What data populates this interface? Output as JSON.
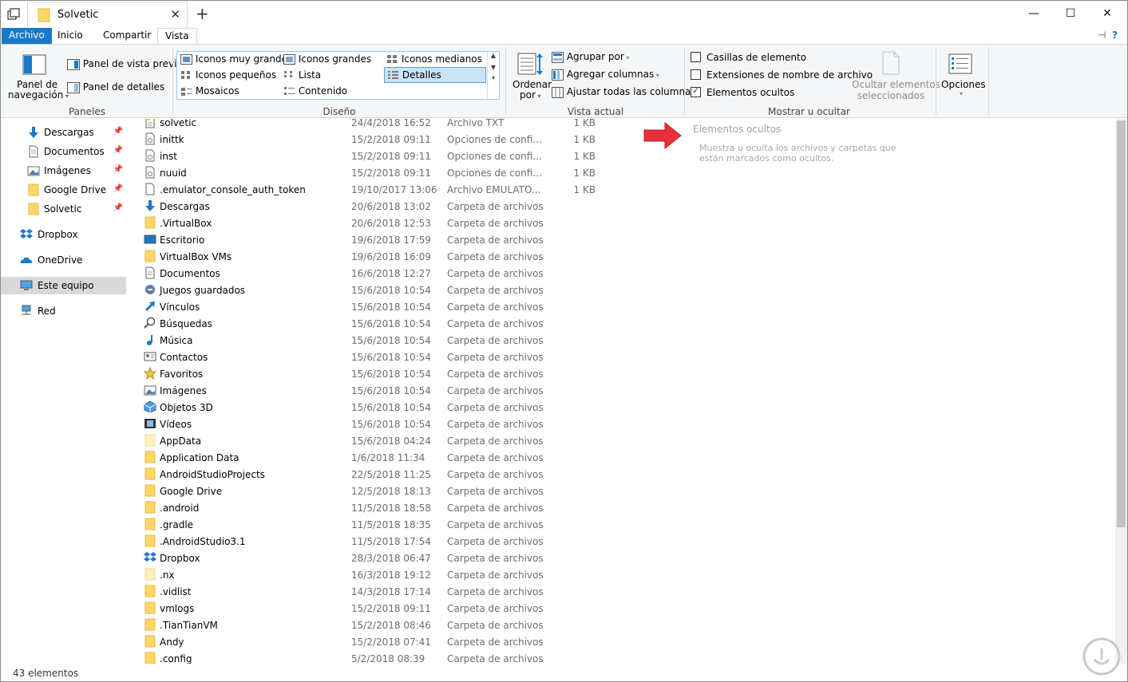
{
  "window": {
    "title": "Solvetic"
  },
  "ribbon_tabs": {
    "archivo": "Archivo",
    "inicio": "Inicio",
    "compartir": "Compartir",
    "vista": "Vista"
  },
  "ribbon": {
    "paneles": {
      "label": "Paneles",
      "nav_pane_line1": "Panel de",
      "nav_pane_line2": "navegación",
      "preview_pane": "Panel de vista previa",
      "details_pane": "Panel de detalles"
    },
    "diseno": {
      "label": "Diseño",
      "items": [
        "Iconos muy grandes",
        "Iconos grandes",
        "Iconos medianos",
        "Iconos pequeños",
        "Lista",
        "Detalles",
        "Mosaicos",
        "Contenido"
      ],
      "selected": "Detalles"
    },
    "vista_actual": {
      "label": "Vista actual",
      "ordenar_line1": "Ordenar",
      "ordenar_line2": "por",
      "agrupar": "Agrupar por",
      "agregar_columnas": "Agregar columnas",
      "ajustar": "Ajustar todas las columnas"
    },
    "mostrar": {
      "label": "Mostrar u ocultar",
      "casillas": "Casillas de elemento",
      "casillas_checked": false,
      "extensiones": "Extensiones de nombre de archivo",
      "extensiones_checked": false,
      "ocultos": "Elementos ocultos",
      "ocultos_checked": true,
      "ocultar_sel_line1": "Ocultar elementos",
      "ocultar_sel_line2": "seleccionados"
    },
    "opciones": "Opciones"
  },
  "nav": {
    "items": [
      {
        "label": "Descargas",
        "icon": "download-arrow-icon",
        "pinned": true
      },
      {
        "label": "Documentos",
        "icon": "document-icon",
        "pinned": true
      },
      {
        "label": "Imágenes",
        "icon": "pictures-icon",
        "pinned": true
      },
      {
        "label": "Google Drive",
        "icon": "folder-icon",
        "pinned": true
      },
      {
        "label": "Solvetic",
        "icon": "folder-icon",
        "pinned": true
      },
      {
        "label": "Dropbox",
        "icon": "dropbox-icon",
        "pinned": false
      },
      {
        "label": "OneDrive",
        "icon": "onedrive-cloud-icon",
        "pinned": false
      },
      {
        "label": "Este equipo",
        "icon": "computer-icon",
        "pinned": false
      },
      {
        "label": "Red",
        "icon": "network-icon",
        "pinned": false
      }
    ],
    "selected": "Este equipo"
  },
  "files": [
    {
      "name": "solvetic",
      "date": "24/4/2018 16:52",
      "type": "Archivo TXT",
      "size": "1 KB",
      "icon": "text-file-icon"
    },
    {
      "name": "inittk",
      "date": "15/2/2018 09:11",
      "type": "Opciones de confi...",
      "size": "1 KB",
      "icon": "settings-file-icon"
    },
    {
      "name": "inst",
      "date": "15/2/2018 09:11",
      "type": "Opciones de confi...",
      "size": "1 KB",
      "icon": "settings-file-icon"
    },
    {
      "name": "nuuid",
      "date": "15/2/2018 09:11",
      "type": "Opciones de confi...",
      "size": "1 KB",
      "icon": "settings-file-icon"
    },
    {
      "name": ".emulator_console_auth_token",
      "date": "19/10/2017 13:06",
      "type": "Archivo EMULATO...",
      "size": "1 KB",
      "icon": "blank-file-icon"
    },
    {
      "name": "Descargas",
      "date": "20/6/2018 13:02",
      "type": "Carpeta de archivos",
      "size": "",
      "icon": "download-arrow-icon"
    },
    {
      "name": ".VirtualBox",
      "date": "20/6/2018 12:53",
      "type": "Carpeta de archivos",
      "size": "",
      "icon": "folder-icon"
    },
    {
      "name": "Escritorio",
      "date": "19/6/2018 17:59",
      "type": "Carpeta de archivos",
      "size": "",
      "icon": "desktop-icon"
    },
    {
      "name": "VirtualBox VMs",
      "date": "19/6/2018 16:09",
      "type": "Carpeta de archivos",
      "size": "",
      "icon": "folder-icon"
    },
    {
      "name": "Documentos",
      "date": "16/6/2018 12:27",
      "type": "Carpeta de archivos",
      "size": "",
      "icon": "document-icon"
    },
    {
      "name": "Juegos guardados",
      "date": "15/6/2018 10:54",
      "type": "Carpeta de archivos",
      "size": "",
      "icon": "saved-games-icon"
    },
    {
      "name": "Vínculos",
      "date": "15/6/2018 10:54",
      "type": "Carpeta de archivos",
      "size": "",
      "icon": "link-arrow-icon"
    },
    {
      "name": "Búsquedas",
      "date": "15/6/2018 10:54",
      "type": "Carpeta de archivos",
      "size": "",
      "icon": "search-icon"
    },
    {
      "name": "Música",
      "date": "15/6/2018 10:54",
      "type": "Carpeta de archivos",
      "size": "",
      "icon": "music-note-icon"
    },
    {
      "name": "Contactos",
      "date": "15/6/2018 10:54",
      "type": "Carpeta de archivos",
      "size": "",
      "icon": "contacts-icon"
    },
    {
      "name": "Favoritos",
      "date": "15/6/2018 10:54",
      "type": "Carpeta de archivos",
      "size": "",
      "icon": "star-icon"
    },
    {
      "name": "Imágenes",
      "date": "15/6/2018 10:54",
      "type": "Carpeta de archivos",
      "size": "",
      "icon": "pictures-icon"
    },
    {
      "name": "Objetos 3D",
      "date": "15/6/2018 10:54",
      "type": "Carpeta de archivos",
      "size": "",
      "icon": "cube-3d-icon"
    },
    {
      "name": "Vídeos",
      "date": "15/6/2018 10:54",
      "type": "Carpeta de archivos",
      "size": "",
      "icon": "film-icon"
    },
    {
      "name": "AppData",
      "date": "15/6/2018 04:24",
      "type": "Carpeta de archivos",
      "size": "",
      "icon": "folder-faded-icon"
    },
    {
      "name": "Application Data",
      "date": "1/6/2018 11:34",
      "type": "Carpeta de archivos",
      "size": "",
      "icon": "folder-icon"
    },
    {
      "name": "AndroidStudioProjects",
      "date": "22/5/2018 11:25",
      "type": "Carpeta de archivos",
      "size": "",
      "icon": "folder-icon"
    },
    {
      "name": "Google Drive",
      "date": "12/5/2018 18:13",
      "type": "Carpeta de archivos",
      "size": "",
      "icon": "folder-icon"
    },
    {
      "name": ".android",
      "date": "11/5/2018 18:58",
      "type": "Carpeta de archivos",
      "size": "",
      "icon": "folder-icon"
    },
    {
      "name": ".gradle",
      "date": "11/5/2018 18:35",
      "type": "Carpeta de archivos",
      "size": "",
      "icon": "folder-icon"
    },
    {
      "name": ".AndroidStudio3.1",
      "date": "11/5/2018 17:54",
      "type": "Carpeta de archivos",
      "size": "",
      "icon": "folder-icon"
    },
    {
      "name": "Dropbox",
      "date": "28/3/2018 06:47",
      "type": "Carpeta de archivos",
      "size": "",
      "icon": "dropbox-icon"
    },
    {
      "name": ".nx",
      "date": "16/3/2018 19:12",
      "type": "Carpeta de archivos",
      "size": "",
      "icon": "folder-faded-icon"
    },
    {
      "name": ".vidlist",
      "date": "14/3/2018 17:14",
      "type": "Carpeta de archivos",
      "size": "",
      "icon": "folder-icon"
    },
    {
      "name": "vmlogs",
      "date": "15/2/2018 09:11",
      "type": "Carpeta de archivos",
      "size": "",
      "icon": "folder-icon"
    },
    {
      "name": ".TianTianVM",
      "date": "15/2/2018 08:46",
      "type": "Carpeta de archivos",
      "size": "",
      "icon": "folder-icon"
    },
    {
      "name": "Andy",
      "date": "15/2/2018 07:41",
      "type": "Carpeta de archivos",
      "size": "",
      "icon": "folder-icon"
    },
    {
      "name": ".config",
      "date": "5/2/2018 08:39",
      "type": "Carpeta de archivos",
      "size": "",
      "icon": "folder-icon"
    }
  ],
  "preview": {
    "title": "Elementos ocultos",
    "description": "Muestra u oculta los archivos y carpetas que están marcados como ocultos."
  },
  "status": {
    "count": "43 elementos"
  },
  "colors": {
    "accent": "#1979ca",
    "selection": "#cce4f7",
    "folder": "#ffd766",
    "arrow": "#e8303a"
  }
}
